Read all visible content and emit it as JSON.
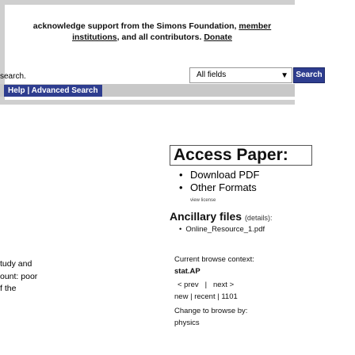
{
  "header": {
    "ack_prefix": "acknowledge support from the Simons Foundation,",
    "ack_member_link": "member",
    "ack_institutions_link": "institutions",
    "ack_middle": ", and all contributors.",
    "ack_donate_link": "Donate"
  },
  "search": {
    "fragment": "search.",
    "field_select": "All fields",
    "button": "Search",
    "help_advanced": "Help | Advanced Search"
  },
  "main_fragment": {
    "line1": "tudy and",
    "line2": "ount: poor",
    "line3": "f the"
  },
  "sidebar": {
    "access_heading": "Access Paper:",
    "access_items": [
      "Download PDF",
      "Other Formats"
    ],
    "view_license": "view license",
    "ancillary_title": "Ancillary files",
    "ancillary_details": "(details):",
    "ancillary_file": "Online_Resource_1.pdf",
    "browse_context_label": "Current browse context:",
    "browse_context_value": "stat.AP",
    "prev": "< prev",
    "separator": "|",
    "next": "next >",
    "new": "new",
    "recent": "recent",
    "listing_num": "1101",
    "change_browse": "Change to browse by:",
    "change_browse_value": "physics"
  },
  "colors": {
    "accent": "#2e3d8f",
    "header_band": "#cfcfcf"
  }
}
